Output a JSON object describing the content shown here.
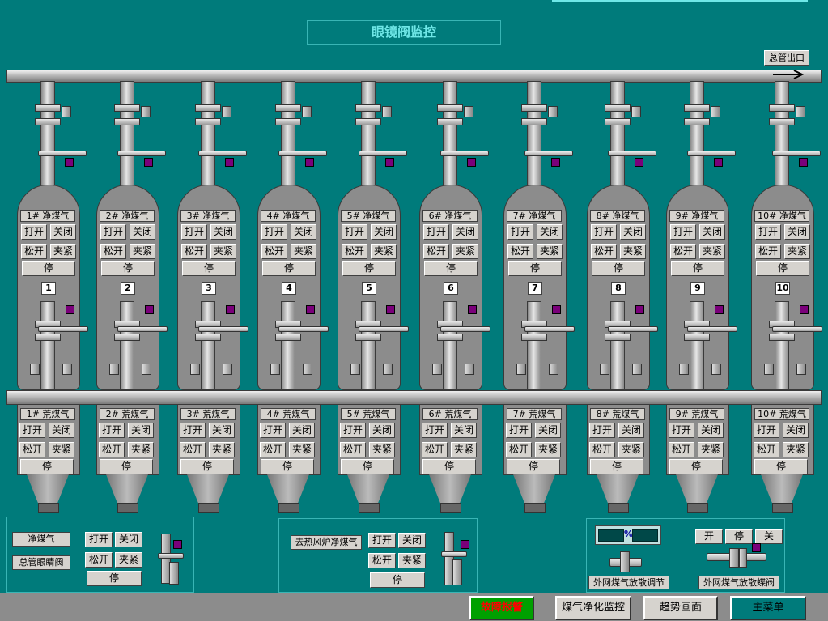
{
  "title": "眼镜阀监控",
  "outlet_label": "总管出口",
  "units": [
    {
      "num": "1",
      "clean": "1# 净煤气",
      "raw": "1# 荒煤气"
    },
    {
      "num": "2",
      "clean": "2# 净煤气",
      "raw": "2# 荒煤气"
    },
    {
      "num": "3",
      "clean": "3# 净煤气",
      "raw": "3# 荒煤气"
    },
    {
      "num": "4",
      "clean": "4# 净煤气",
      "raw": "4# 荒煤气"
    },
    {
      "num": "5",
      "clean": "5# 净煤气",
      "raw": "5# 荒煤气"
    },
    {
      "num": "6",
      "clean": "6# 净煤气",
      "raw": "6# 荒煤气"
    },
    {
      "num": "7",
      "clean": "7# 净煤气",
      "raw": "7# 荒煤气"
    },
    {
      "num": "8",
      "clean": "8# 净煤气",
      "raw": "8# 荒煤气"
    },
    {
      "num": "9",
      "clean": "9# 净煤气",
      "raw": "9# 荒煤气"
    },
    {
      "num": "10",
      "clean": "10# 净煤气",
      "raw": "10# 荒煤气"
    }
  ],
  "buttons": {
    "open": "打开",
    "close": "关闭",
    "loosen": "松开",
    "clamp": "夹紧",
    "stop": "停"
  },
  "main_valve": {
    "label1": "净煤气",
    "label2": "总管眼睛阀"
  },
  "hot_blast": {
    "label": "去热风炉净煤气"
  },
  "external": {
    "pct_symbol": "%",
    "open": "开",
    "stop": "停",
    "close": "关",
    "adjust_label": "外网煤气放散调节",
    "butterfly_label": "外网煤气放散蝶阀"
  },
  "nav": {
    "alarm": "故障报警",
    "purify": "煤气净化监控",
    "trend": "趋势画面",
    "menu": "主菜单"
  },
  "colors": {
    "background": "#007b7b",
    "indicator": "#7a007a",
    "alarm_bg": "#00a000",
    "alarm_fg": "#ff0000"
  }
}
